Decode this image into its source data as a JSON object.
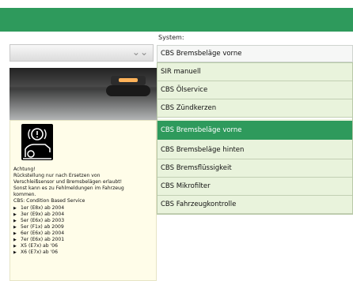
{
  "colors": {
    "accent": "#2e9a5c",
    "dropdown_bg": "#e9f3dc",
    "info_bg": "#fffde9"
  },
  "left_select": {
    "icon": "chevron-down-icon"
  },
  "system": {
    "label": "System:",
    "selected": "CBS Bremsbeläge vorne"
  },
  "dropdown": {
    "items": [
      "SIR manuell",
      "CBS Ölservice",
      "CBS Zündkerzen",
      "CBS Bremsbeläge vorne",
      "CBS Bremsbeläge hinten",
      "CBS Bremsflüssigkeit",
      "CBS Mikrofilter",
      "CBS Fahrzeugkontrolle"
    ],
    "selected_index": 3
  },
  "info": {
    "icon": "brake-pad-warning-icon",
    "lines": [
      "Achtung!",
      "Rückstellung nur nach Ersetzen von",
      "Verschleißsensor und Bremsbelägen erlaubt!",
      "Sonst kann es zu Fehlmeldungen im Fahrzeug",
      "kommen.",
      "CBS: Condition Based Service"
    ],
    "models": [
      "1er (E8x) ab 2004",
      "3er (E9x) ab 2004",
      "5er (E6x) ab 2003",
      "5er (F1x) ab 2009",
      "6er (E6x) ab 2004",
      "7er (E6x) ab 2001",
      "X5 (E7x) ab '06",
      "X6 (E7x) ab '06"
    ]
  }
}
